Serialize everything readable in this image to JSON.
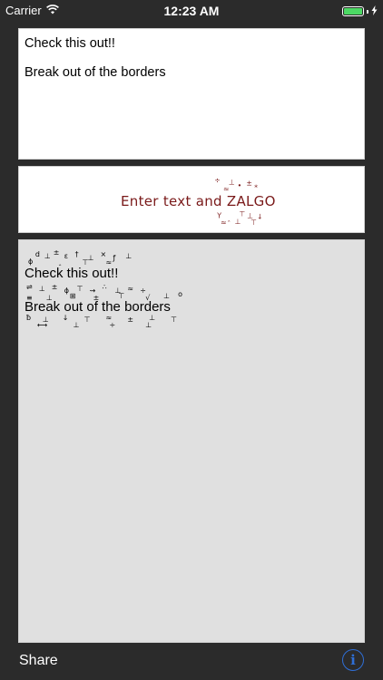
{
  "status": {
    "carrier": "Carrier",
    "time": "12:23 AM",
    "battery_level": 1.0,
    "battery_color": "#4cd964"
  },
  "input": {
    "line1": "Check this out!!",
    "line2": "Break out of the borders"
  },
  "banner": {
    "text": "Enter text and ZALGO",
    "text_color": "#7a1a1a"
  },
  "output": {
    "line1": "Check this out!!",
    "line2": "Break out of the borders"
  },
  "toolbar": {
    "share_label": "Share",
    "info_glyph": "i",
    "info_color": "#2f6fd6"
  },
  "icons": [
    "wifi-icon",
    "battery-icon",
    "charging-icon",
    "info-icon"
  ]
}
